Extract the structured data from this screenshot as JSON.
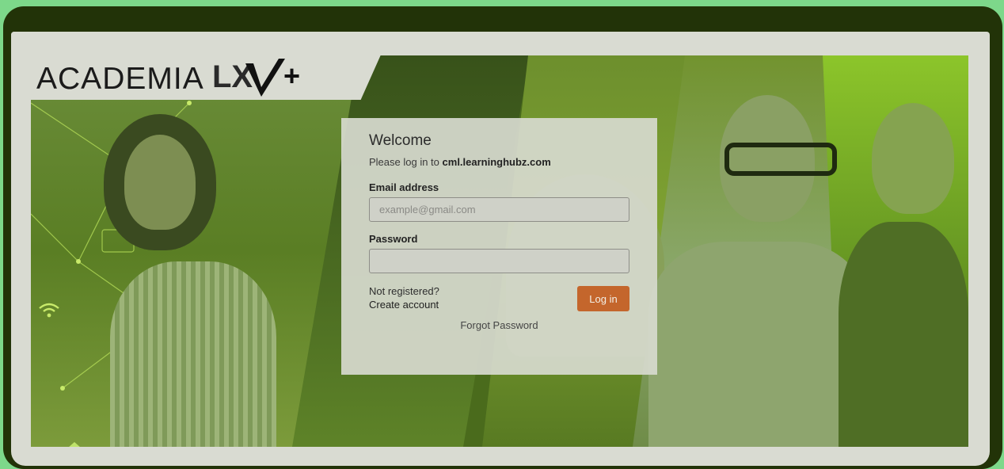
{
  "brand": {
    "wordmark": "ACADEMIA",
    "mark_text": "LX",
    "mark_suffix": "+"
  },
  "login": {
    "title": "Welcome",
    "subtitle_prefix": "Please log in to",
    "subtitle_domain": "cml.learninghubz.com",
    "email_label": "Email address",
    "email_placeholder": "example@gmail.com",
    "email_value": "",
    "password_label": "Password",
    "password_value": "",
    "not_registered": "Not registered?",
    "create_account": "Create account",
    "login_button": "Log in",
    "forgot_password": "Forgot Password"
  },
  "icons": [
    "home-icon",
    "wifi-icon",
    "network-icon"
  ],
  "colors": {
    "accent_orange": "#c4662c",
    "brand_green": "#7dd88a",
    "frame_dark": "#223308"
  }
}
